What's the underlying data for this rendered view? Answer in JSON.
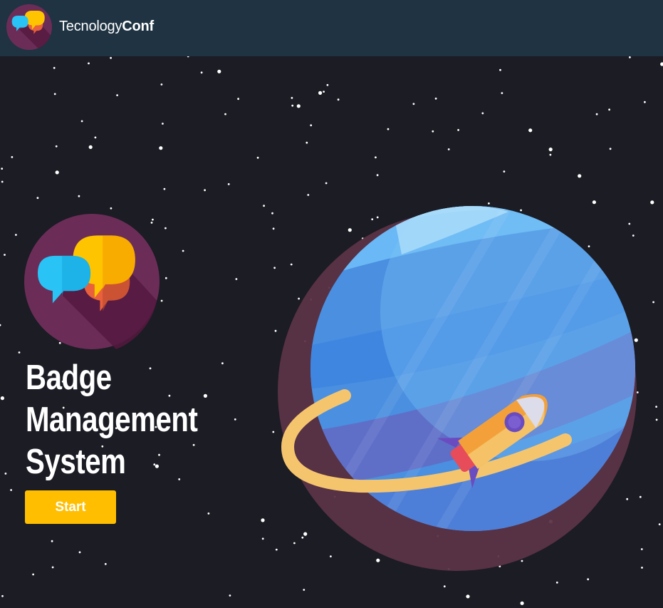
{
  "navbar": {
    "brand_light": "Tecnology",
    "brand_bold": "Conf",
    "logo_icon": "chat-bubbles-logo"
  },
  "hero": {
    "title_lines": [
      "Badge",
      "Management",
      "System"
    ],
    "start_label": "Start",
    "logo_icon": "chat-bubbles-logo",
    "illustration": "planet-with-rocket"
  },
  "colors": {
    "navbar_bg": "#1f3342",
    "hero_bg": "#1b1c24",
    "accent_button": "#ffbe00",
    "logo_circle": "#6b2d57",
    "planet_blue": "#4a8fe0",
    "planet_shadow": "#5b3347",
    "ring": "#f5c56e",
    "bubble_blue": "#29c3f5",
    "bubble_yellow": "#ffc400",
    "bubble_orange": "#e8603c"
  }
}
